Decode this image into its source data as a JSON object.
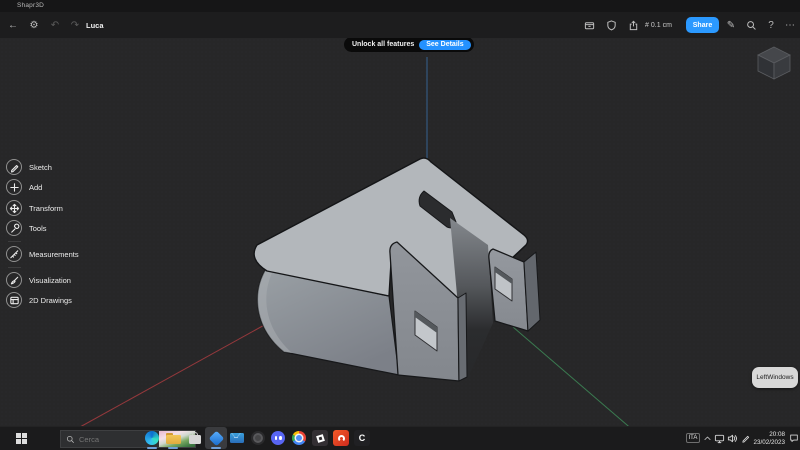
{
  "app": {
    "title": "Shapr3D"
  },
  "toolbar": {
    "project_name": "Luca",
    "grid_value": "0.1 cm",
    "share_label": "Share",
    "icons": {
      "back": "←",
      "settings": "⚙",
      "undo": "↶",
      "redo": "↷",
      "grid": "#",
      "pencil": "✎",
      "help": "?",
      "more": "⋯"
    }
  },
  "banner": {
    "message": "Unlock all features",
    "cta": "See Details"
  },
  "sidebar": {
    "items": [
      {
        "label": "Sketch"
      },
      {
        "label": "Add"
      },
      {
        "label": "Transform"
      },
      {
        "label": "Tools"
      },
      {
        "label": "Measurements"
      },
      {
        "label": "Visualization"
      },
      {
        "label": "2D Drawings"
      }
    ]
  },
  "viewport": {
    "view_label": "LeftWindows"
  },
  "taskbar": {
    "search_placeholder": "Cerca",
    "apps": [
      "edge",
      "file-explorer",
      "microsoft-store",
      "shapr3d",
      "mail",
      "camera",
      "discord",
      "chrome",
      "roblox",
      "acrobat",
      "clipchamp"
    ],
    "clipchamp_glyph": "C"
  },
  "tray": {
    "language": "ITA",
    "time": "20:08",
    "date": "23/02/2023"
  },
  "colors": {
    "accent": "#2b99ff",
    "model_gray": "#b3b7bb",
    "axis_x": "#94383c",
    "axis_y": "#3a7a50",
    "axis_z": "#33587f"
  }
}
